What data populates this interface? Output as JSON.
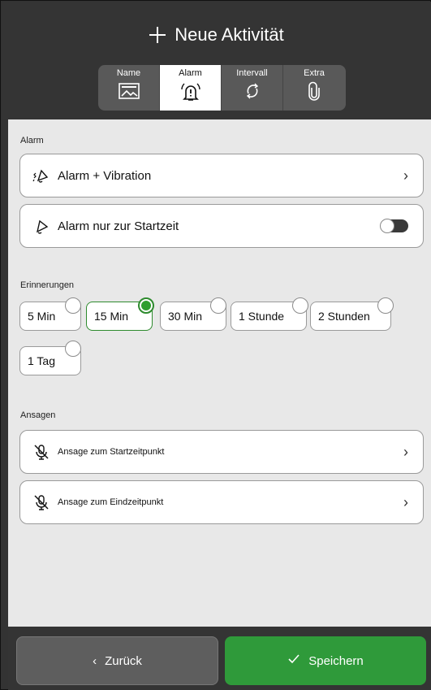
{
  "header": {
    "title": "Neue Aktivität",
    "tabs": [
      {
        "label": "Name",
        "icon": "image-icon",
        "active": false
      },
      {
        "label": "Alarm",
        "icon": "bell-alert-icon",
        "active": true
      },
      {
        "label": "Intervall",
        "icon": "repeat-icon",
        "active": false
      },
      {
        "label": "Extra",
        "icon": "paperclip-icon",
        "active": false
      }
    ]
  },
  "alarm": {
    "section_label": "Alarm",
    "items": [
      {
        "label": "Alarm + Vibration",
        "icon": "bell-vibrate-icon",
        "trailing": "chevron"
      },
      {
        "label": "Alarm nur zur Startzeit",
        "icon": "bell-icon",
        "trailing": "toggle",
        "toggle_on": false
      }
    ]
  },
  "reminders": {
    "section_label": "Erinnerungen",
    "options": [
      {
        "label": "5 Min",
        "selected": false
      },
      {
        "label": "15 Min",
        "selected": true
      },
      {
        "label": "30 Min",
        "selected": false
      },
      {
        "label": "1 Stunde",
        "selected": false
      },
      {
        "label": "2 Stunden",
        "selected": false
      },
      {
        "label": "1 Tag",
        "selected": false
      }
    ]
  },
  "announcements": {
    "section_label": "Ansagen",
    "items": [
      {
        "label": "Ansage zum Startzeitpunkt",
        "icon": "mic-off-icon"
      },
      {
        "label": "Ansage zum Eindzeitpunkt",
        "icon": "mic-off-icon"
      }
    ]
  },
  "footer": {
    "back_label": "Zurück",
    "save_label": "Speichern"
  },
  "colors": {
    "accent": "#2f9a3a",
    "header_bg": "#343434",
    "content_bg": "#e8e8e8"
  }
}
